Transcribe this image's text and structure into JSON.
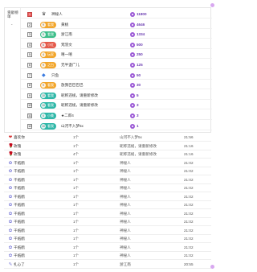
{
  "side": {
    "label": "贡献榜单",
    "caret": "⌄"
  },
  "ranking": [
    {
      "rank": "1",
      "badge": "",
      "name": "神秘人",
      "value": "11800",
      "color": "#e45b4b",
      "crown": true
    },
    {
      "rank": "2",
      "badge": "9",
      "badge_text": "看我",
      "name": "黄桃",
      "value": "4646",
      "color": "#f2a62c"
    },
    {
      "rank": "3",
      "badge": "9",
      "badge_text": "看我",
      "name": "浙江南",
      "value": "1334",
      "color": "#3dbe8a"
    },
    {
      "rank": "4",
      "badge": "6",
      "badge_text": "小红",
      "name": "梵羽文",
      "value": "500",
      "color": "#e45b4b"
    },
    {
      "rank": "5",
      "badge": "4",
      "badge_text": "玩家",
      "name": "嘻一嘻",
      "value": "250",
      "color": "#f2a62c"
    },
    {
      "rank": "6",
      "badge": "9",
      "badge_text": "之白",
      "name": "无半盏广儿",
      "value": "125",
      "color": "#f2a62c"
    },
    {
      "rank": "7",
      "badge": "",
      "badge_text": "",
      "name": "只鱼",
      "value": "50",
      "color": "#5a8ee6",
      "diamond": true
    },
    {
      "rank": "8",
      "badge": "9",
      "badge_text": "看我",
      "name": "放我巴巴巴巴",
      "value": "30",
      "color": "#f2a62c"
    },
    {
      "rank": "9",
      "badge": "10",
      "badge_text": "看我",
      "name": "昵称违规，请重新修改",
      "value": "5",
      "color": "#2fb7a8"
    },
    {
      "rank": "10",
      "badge": "10",
      "badge_text": "看我",
      "name": "昵称违规，请重新修改",
      "value": "3",
      "color": "#2fb7a8"
    },
    {
      "rank": "11",
      "badge": "4",
      "badge_text": "小美",
      "name": "★二郎4",
      "value": "3",
      "color": "#2fb7a8"
    },
    {
      "rank": "12",
      "badge": "10",
      "badge_text": "看我",
      "name": "山河不入梦5x",
      "value": "1",
      "color": "#2fb7a8"
    }
  ],
  "gift_log": [
    {
      "icon": "❤",
      "gift": "喜欢你",
      "qty": "1个",
      "user": "山河不入梦5x",
      "time": "21:56"
    },
    {
      "icon": "🌹",
      "gift": "玫瑰",
      "qty": "1个",
      "user": "昵称违规，请重新修改",
      "time": "21:16"
    },
    {
      "icon": "🌹",
      "gift": "玫瑰",
      "qty": "4个",
      "user": "昵称违规，请重新修改",
      "time": "21:16"
    },
    {
      "icon": "✿",
      "gift": "千纸鹤",
      "qty": "1个",
      "user": "神秘人",
      "time": "21:02"
    },
    {
      "icon": "✿",
      "gift": "千纸鹤",
      "qty": "1个",
      "user": "神秘人",
      "time": "21:02"
    },
    {
      "icon": "✿",
      "gift": "千纸鹤",
      "qty": "1个",
      "user": "神秘人",
      "time": "21:02"
    },
    {
      "icon": "✿",
      "gift": "千纸鹤",
      "qty": "1个",
      "user": "神秘人",
      "time": "21:02"
    },
    {
      "icon": "✿",
      "gift": "千纸鹤",
      "qty": "1个",
      "user": "神秘人",
      "time": "21:02"
    },
    {
      "icon": "✿",
      "gift": "千纸鹤",
      "qty": "1个",
      "user": "神秘人",
      "time": "21:02"
    },
    {
      "icon": "✿",
      "gift": "千纸鹤",
      "qty": "1个",
      "user": "神秘人",
      "time": "21:02"
    },
    {
      "icon": "✿",
      "gift": "千纸鹤",
      "qty": "1个",
      "user": "神秘人",
      "time": "21:02"
    },
    {
      "icon": "✿",
      "gift": "千纸鹤",
      "qty": "1个",
      "user": "神秘人",
      "time": "21:02"
    },
    {
      "icon": "✿",
      "gift": "千纸鹤",
      "qty": "1个",
      "user": "神秘人",
      "time": "21:02"
    },
    {
      "icon": "✿",
      "gift": "千纸鹤",
      "qty": "1个",
      "user": "神秘人",
      "time": "21:02"
    },
    {
      "icon": "✿",
      "gift": "千纸鹤",
      "qty": "1个",
      "user": "神秘人",
      "time": "21:02"
    },
    {
      "icon": "✎",
      "gift": "扎心了",
      "qty": "1个",
      "user": "浙江南",
      "time": "20:55"
    }
  ]
}
